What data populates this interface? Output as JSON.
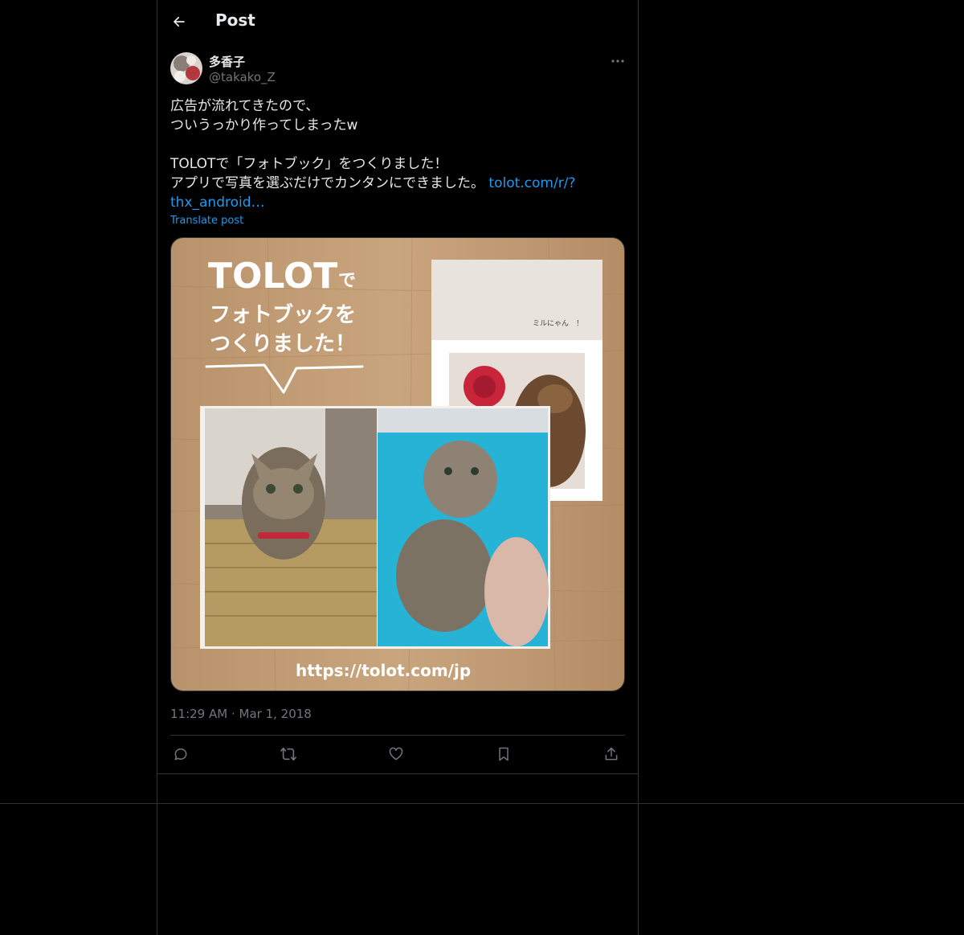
{
  "header": {
    "title": "Post"
  },
  "post": {
    "author_name": "多香子",
    "author_handle": "@takako_Z",
    "text_line1": "広告が流れてきたので、",
    "text_line2": "ついうっかり作ってしまったw",
    "text_line3": "TOLOTで「フォトブック」をつくりました！",
    "text_line4": "アプリで写真を選ぶだけでカンタンにできました。",
    "link_part1": "tolot.com/r/?",
    "link_part2": "thx_android…",
    "translate_label": "Translate post",
    "timestamp": "11:29 AM · Mar 1, 2018"
  },
  "media": {
    "brand": "TOLOT",
    "brand_suffix": "で",
    "headline1": "フォトブックを",
    "headline2": "つくりました！",
    "page_caption": "ミルにゃん　！",
    "url": "https://tolot.com/jp"
  },
  "colors": {
    "background": "#000000",
    "text": "#e7e9ea",
    "muted": "#71767b",
    "link": "#1d9bf0",
    "border": "#2f3336"
  },
  "icons": {
    "back": "arrow-left-icon",
    "more": "more-horizontal-icon",
    "reply": "reply-icon",
    "repost": "repost-icon",
    "like": "heart-icon",
    "bookmark": "bookmark-icon",
    "share": "share-icon"
  }
}
